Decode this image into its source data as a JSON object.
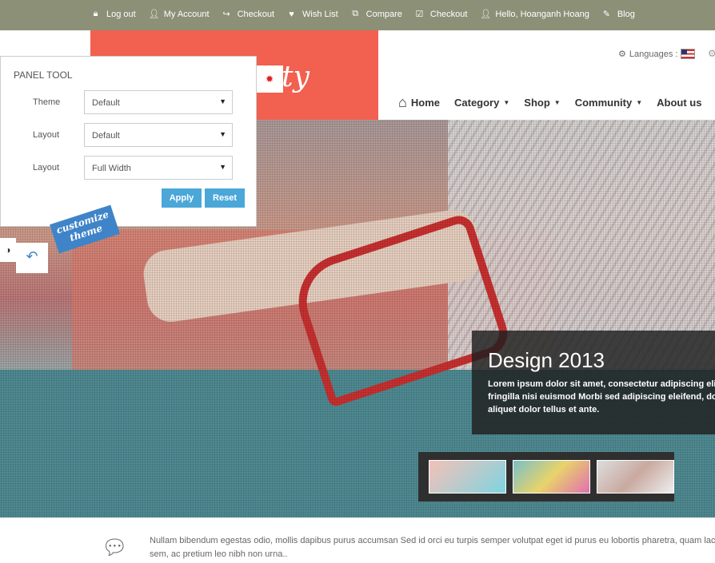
{
  "topbar": {
    "links": [
      {
        "icon": "lock-icon",
        "label": "Log out"
      },
      {
        "icon": "user-icon",
        "label": "My Account"
      },
      {
        "icon": "share-icon",
        "label": "Checkout"
      },
      {
        "icon": "heart-icon",
        "label": "Wish List"
      },
      {
        "icon": "compare-icon",
        "label": "Compare"
      },
      {
        "icon": "check-icon",
        "label": "Checkout"
      },
      {
        "icon": "user-icon",
        "label": "Hello, Hoanganh Hoang"
      },
      {
        "icon": "edit-icon",
        "label": "Blog"
      }
    ]
  },
  "header": {
    "logo_text": "uty",
    "languages_label": "Languages :",
    "menu": [
      {
        "label": "Home",
        "dropdown": false
      },
      {
        "label": "Category",
        "dropdown": true
      },
      {
        "label": "Shop",
        "dropdown": true
      },
      {
        "label": "Community",
        "dropdown": true
      },
      {
        "label": "About us",
        "dropdown": false
      }
    ]
  },
  "panel": {
    "title": "PANEL TOOL",
    "rows": [
      {
        "label": "Theme",
        "value": "Default"
      },
      {
        "label": "Layout",
        "value": "Default"
      },
      {
        "label": "Layout",
        "value": "Full Width"
      }
    ],
    "apply_label": "Apply",
    "reset_label": "Reset",
    "ribbon_line1": "customize",
    "ribbon_line2": "theme"
  },
  "slider": {
    "caption_title": "Design 2013",
    "caption_line1": "Lorem ipsum dolor sit amet, consectetur adipiscing elit. Nu",
    "caption_line2": "fringilla nisi euismod Morbi sed adipiscing eleifend, dolor n",
    "caption_line3": "aliquet dolor tellus et ante."
  },
  "bottom": {
    "line1": "Nullam bibendum egestas odio, mollis dapibus purus accumsan Sed id orci eu turpis semper volutpat eget id purus eu lobortis pharetra, quam lac",
    "line2": "sem, ac pretium leo nibh non urna.."
  },
  "colors": {
    "accent": "#f2604f",
    "button": "#4aa7d8",
    "topbar": "#8c9077"
  }
}
